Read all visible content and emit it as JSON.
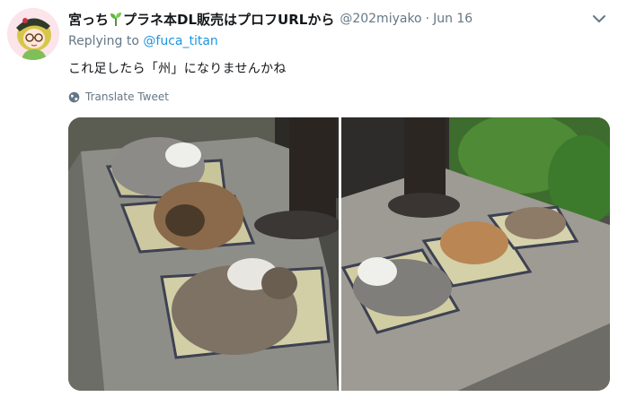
{
  "tweet": {
    "display_name_part1": "宮っち",
    "display_name_part2": "プラネ本DL販売はプロフURLから",
    "handle": "@202miyako",
    "separator": "·",
    "date": "Jun 16",
    "replying_prefix": "Replying to ",
    "replying_handle": "@fuca_titan",
    "text": "これ足したら「州」になりませんかね",
    "translate_label": "Translate Tweet"
  },
  "icons": {
    "name_emoji": "sprout-icon",
    "caret": "chevron-down-icon",
    "translate": "globe-icon"
  },
  "colors": {
    "link": "#1b95e0",
    "secondary_text": "#657786",
    "primary_text": "#14171a"
  }
}
